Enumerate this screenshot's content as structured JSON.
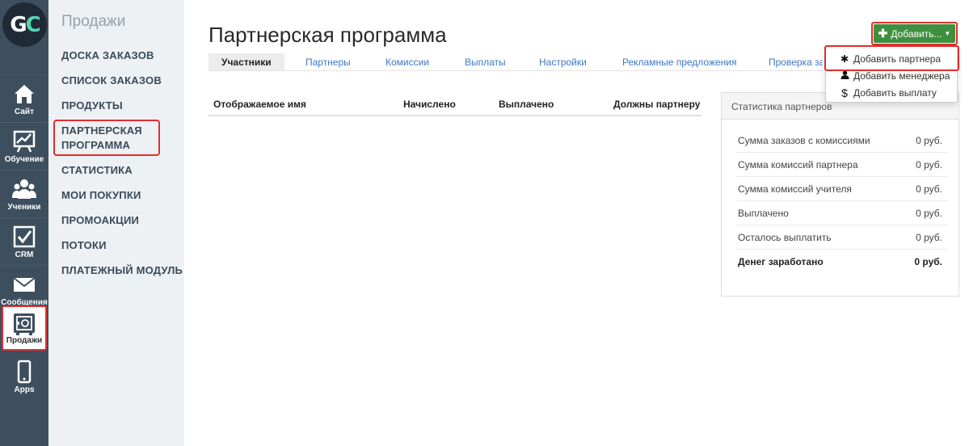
{
  "rail": {
    "logo": {
      "g": "G",
      "c": "C"
    },
    "items": [
      {
        "label": "Сайт",
        "icon": "home-icon"
      },
      {
        "label": "Обучение",
        "icon": "chart-board-icon"
      },
      {
        "label": "Ученики",
        "icon": "users-icon"
      },
      {
        "label": "CRM",
        "icon": "checkbox-icon"
      },
      {
        "label": "Сообщения",
        "icon": "envelope-icon"
      },
      {
        "label": "Продажи",
        "icon": "safe-icon"
      },
      {
        "label": "Apps",
        "icon": "phone-icon"
      }
    ]
  },
  "section": {
    "title": "Продажи",
    "items": [
      "ДОСКА ЗАКАЗОВ",
      "СПИСОК ЗАКАЗОВ",
      "ПРОДУКТЫ",
      "ПАРТНЕРСКАЯ",
      "ПРОГРАММА",
      "СТАТИСТИКА",
      "МОИ ПОКУПКИ",
      "ПРОМОАКЦИИ",
      "ПОТОКИ",
      "ПЛАТЕЖНЫЙ МОДУЛЬ"
    ]
  },
  "main": {
    "title": "Партнерская программа",
    "tabs": [
      "Участники",
      "Партнеры",
      "Комиссии",
      "Выплаты",
      "Настройки",
      "Рекламные предложения",
      "Проверка заказов"
    ],
    "table": {
      "columns": [
        "Отображаемое имя",
        "Начислено",
        "Выплачено",
        "Должны партнеру"
      ]
    }
  },
  "stats": {
    "title": "Статистика партнеров",
    "rows": [
      {
        "label": "Сумма заказов с комиссиями",
        "value": "0 руб."
      },
      {
        "label": "Сумма комиссий партнера",
        "value": "0 руб."
      },
      {
        "label": "Сумма комиссий учителя",
        "value": "0 руб."
      },
      {
        "label": "Выплачено",
        "value": "0 руб."
      },
      {
        "label": "Осталось выплатить",
        "value": "0 руб."
      },
      {
        "label": "Денег заработано",
        "value": "0 руб."
      }
    ]
  },
  "add_menu": {
    "button_label": "Добавить...",
    "items": [
      {
        "label": "Добавить партнера",
        "icon": "asterisk-icon"
      },
      {
        "label": "Добавить менеджера",
        "icon": "person-icon"
      },
      {
        "label": "Добавить выплату",
        "icon": "dollar-icon"
      }
    ]
  },
  "colors": {
    "rail_bg": "#3d4e5e",
    "section_bg": "#eef1f4",
    "accent_green": "#3e8f3e",
    "highlight_red": "#e02f2f",
    "link_blue": "#3b78c6"
  }
}
